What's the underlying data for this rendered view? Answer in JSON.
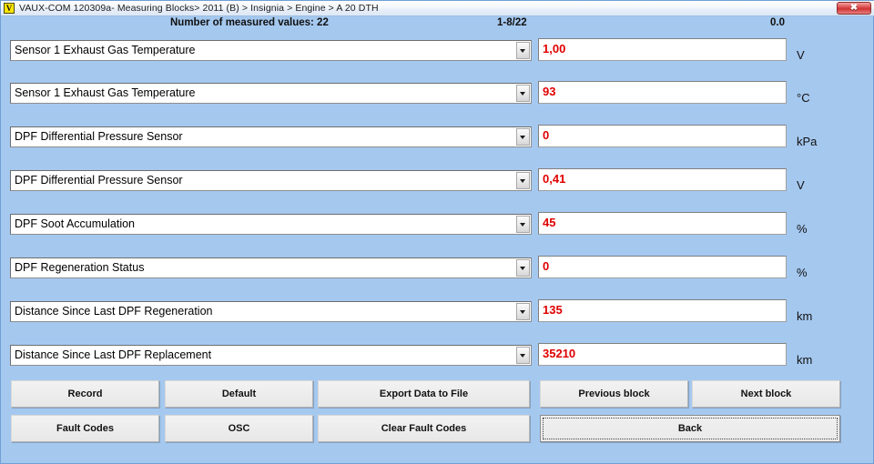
{
  "window": {
    "icon_letter": "V",
    "title": "VAUX-COM 120309a- Measuring Blocks> 2011 (B) > Insignia > Engine > A 20 DTH",
    "close_label": "✖"
  },
  "header": {
    "count_text": "Number of measured values: 22",
    "range_text": "1-8/22",
    "value_text": "0.0"
  },
  "rows": [
    {
      "name": "Sensor 1 Exhaust Gas Temperature",
      "value": "1,00",
      "unit": "V"
    },
    {
      "name": "Sensor 1 Exhaust Gas Temperature",
      "value": "93",
      "unit": "°C"
    },
    {
      "name": "DPF Differential Pressure Sensor",
      "value": "0",
      "unit": "kPa"
    },
    {
      "name": "DPF Differential Pressure Sensor",
      "value": "0,41",
      "unit": "V"
    },
    {
      "name": "DPF Soot Accumulation",
      "value": "45",
      "unit": "%"
    },
    {
      "name": "DPF Regeneration Status",
      "value": "0",
      "unit": "%"
    },
    {
      "name": "Distance Since Last DPF Regeneration",
      "value": "135",
      "unit": "km"
    },
    {
      "name": "Distance Since Last DPF Replacement",
      "value": "35210",
      "unit": "km"
    }
  ],
  "buttons": {
    "record": "Record",
    "default": "Default",
    "export": "Export Data to File",
    "previous_block": "Previous block",
    "next_block": "Next block",
    "fault_codes": "Fault Codes",
    "osc": "OSC",
    "clear_fault_codes": "Clear Fault Codes",
    "back": "Back"
  },
  "colors": {
    "background": "#a5c8ef",
    "value_text": "#e00000",
    "close_button": "#cf3434",
    "title_icon": "#ffe600"
  }
}
